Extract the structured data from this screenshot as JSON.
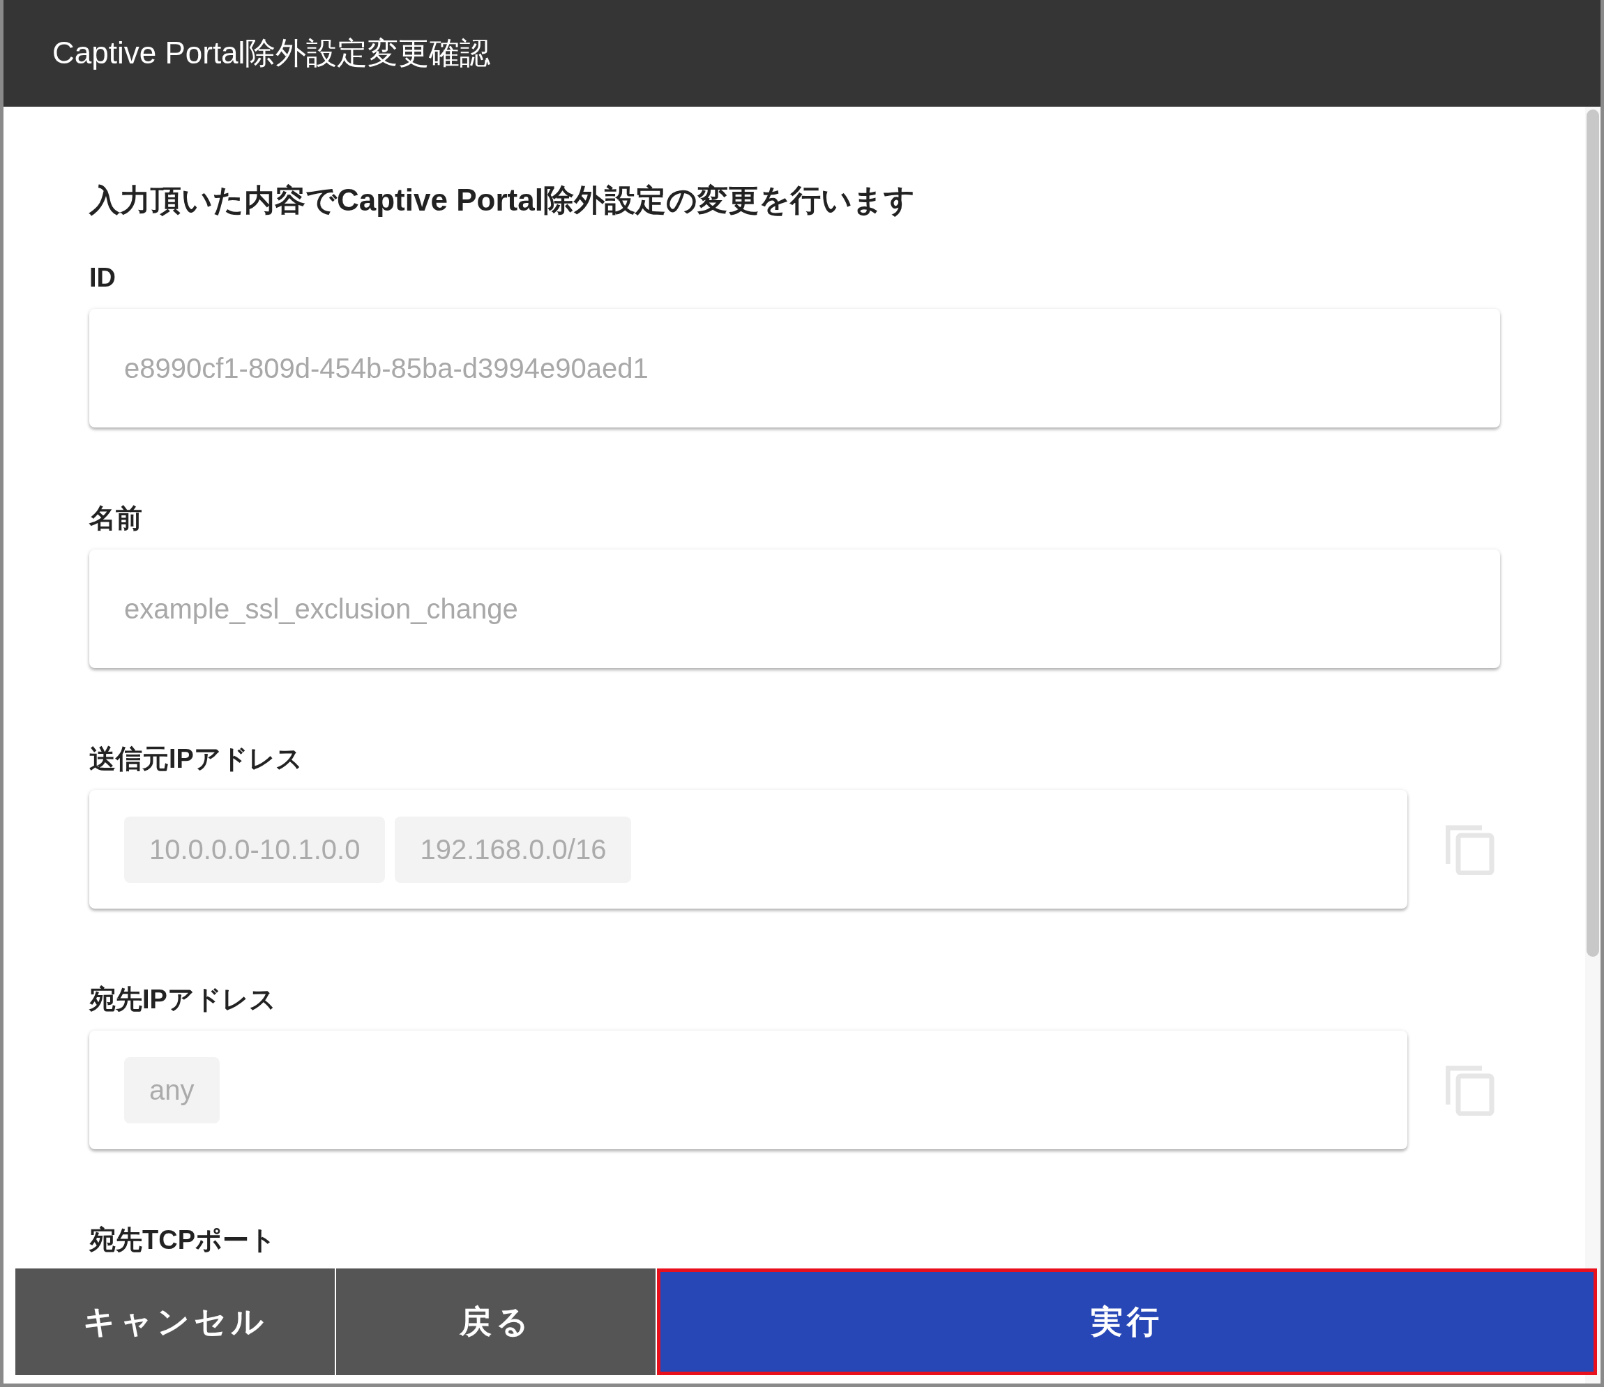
{
  "window": {
    "title": "Captive Portal除外設定変更確認"
  },
  "description": "入力頂いた内容でCaptive Portal除外設定の変更を行います",
  "fields": [
    {
      "label": "ID",
      "kind": "text",
      "value": "e8990cf1-809d-454b-85ba-d3994e90aed1"
    },
    {
      "label": "名前",
      "kind": "text",
      "value": "example_ssl_exclusion_change"
    },
    {
      "label": "送信元IPアドレス",
      "kind": "chips",
      "chips": [
        "10.0.0.0-10.1.0.0",
        "192.168.0.0/16"
      ]
    },
    {
      "label": "宛先IPアドレス",
      "kind": "chips",
      "chips": [
        "any"
      ]
    },
    {
      "label": "宛先TCPポート",
      "kind": "hidden"
    }
  ],
  "buttons": [
    {
      "label": "キャンセル",
      "kind": "secondary",
      "focused": false
    },
    {
      "label": "戻る",
      "kind": "secondary",
      "focused": false
    },
    {
      "label": "実行",
      "kind": "primary",
      "focused": true
    }
  ]
}
